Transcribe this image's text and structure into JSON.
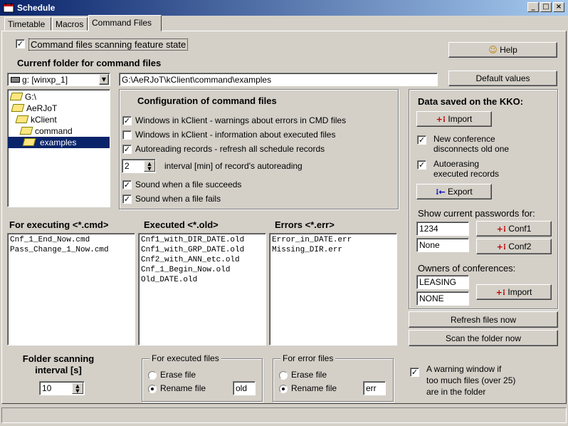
{
  "window": {
    "title": "Schedule",
    "controls": {
      "minimize": "_",
      "maximize": "□",
      "close": "×"
    }
  },
  "tabs": [
    {
      "label": "Timetable"
    },
    {
      "label": "Macros"
    },
    {
      "label": "Command Files",
      "active": true
    }
  ],
  "feature": {
    "label": "Command files scanning feature state",
    "checked": true
  },
  "help_button": "Help",
  "current_folder": {
    "heading": "Currenf folder for command files",
    "drive": "g: [winxp_1]",
    "path": "G:\\AeRJoT\\kClient\\command\\examples"
  },
  "default_values_button": "Default values",
  "tree": [
    {
      "label": "G:\\",
      "level": 0,
      "open": true
    },
    {
      "label": "AeRJoT",
      "level": 1,
      "open": true
    },
    {
      "label": "kClient",
      "level": 2,
      "open": true
    },
    {
      "label": "command",
      "level": 3,
      "open": true
    },
    {
      "label": "examples",
      "level": 4,
      "open": true,
      "selected": true
    }
  ],
  "config": {
    "heading": "Configuration of command files",
    "options": [
      {
        "label": "Windows in kClient - warnings about errors in CMD files",
        "checked": true
      },
      {
        "label": "Windows in kClient - information about executed files",
        "checked": false
      },
      {
        "label": "Autoreading records - refresh all schedule records",
        "checked": true
      }
    ],
    "interval_value": "2",
    "interval_label": "interval [min] of record's autoreading",
    "sound_options": [
      {
        "label": "Sound when a file succeeds",
        "checked": true
      },
      {
        "label": "Sound when a file fails",
        "checked": true
      }
    ]
  },
  "kko": {
    "heading": "Data saved on the KKO:",
    "import_label": "Import",
    "new_conf": {
      "line1": "New conference",
      "line2": "disconnects old one",
      "checked": true
    },
    "autoerase": {
      "line1": "Autoerasing",
      "line2": "executed records",
      "checked": true
    },
    "export_label": "Export",
    "passwords_heading": "Show current passwords for:",
    "pass1": "1234",
    "pass2": "None",
    "conf1_label": "Conf1",
    "conf2_label": "Conf2",
    "owners_heading": "Owners of conferences:",
    "owner1": "LEASING",
    "owner2": "NONE",
    "owners_import_label": "Import"
  },
  "refresh_button": "Refresh files now",
  "scan_button": "Scan the folder now",
  "lists": {
    "executing": {
      "heading": "For executing <*.cmd>",
      "items": [
        "Cnf_1_End_Now.cmd",
        "Pass_Change_1_Now.cmd"
      ]
    },
    "executed": {
      "heading": "Executed <*.old>",
      "items": [
        "Cnf1_with_DIR_DATE.old",
        "Cnf1_with_GRP_DATE.old",
        "Cnf2_with_ANN_etc.old",
        "Cnf_1_Begin_Now.old",
        "Old_DATE.old"
      ]
    },
    "errors": {
      "heading": "Errors <*.err>",
      "items": [
        "Error_in_DATE.err",
        "Missing_DIR.err"
      ]
    }
  },
  "scanning": {
    "line1": "Folder scanning",
    "line2": "interval [s]",
    "value": "10"
  },
  "executed_group": {
    "legend": "For executed files",
    "erase_label": "Erase file",
    "rename_label": "Rename file",
    "ext": "old",
    "selected": "rename"
  },
  "error_group": {
    "legend": "For error files",
    "erase_label": "Erase file",
    "rename_label": "Rename file",
    "ext": "err",
    "selected": "rename"
  },
  "warning": {
    "checked": true,
    "line1": "A warning window if",
    "line2": "too much files (over 25)",
    "line3": "are in the folder"
  },
  "colors": {
    "face": "#d4d0c8",
    "title_start": "#0a246a",
    "title_end": "#a6caf0",
    "selection": "#0a246a"
  }
}
